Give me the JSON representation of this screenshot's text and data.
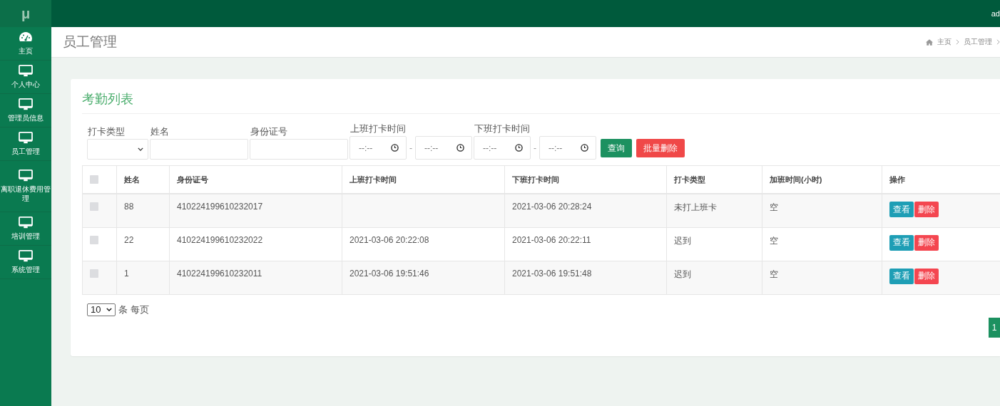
{
  "logo": "μ",
  "top_bar": {
    "user": "ad"
  },
  "sidebar": {
    "items": [
      {
        "label": "主页",
        "kind": "dashboard",
        "selected": false
      },
      {
        "label": "个人中心",
        "kind": "monitor",
        "selected": false
      },
      {
        "label": "管理员信息",
        "kind": "monitor",
        "selected": false
      },
      {
        "label": "员工管理",
        "kind": "monitor",
        "selected": false
      },
      {
        "label": "离职退休费用管理",
        "kind": "monitor",
        "selected": false
      },
      {
        "label": "培训管理",
        "kind": "monitor",
        "selected": false
      },
      {
        "label": "系统管理",
        "kind": "monitor",
        "selected": false
      }
    ]
  },
  "header": {
    "title": "员工管理",
    "breadcrumb": [
      "主页",
      "员工管理"
    ]
  },
  "card": {
    "title": "考勤列表",
    "filters": {
      "type_label": "打卡类型",
      "name_label": "姓名",
      "id_label": "身份证号",
      "start_label": "上班打卡时间",
      "start_from": "--:--",
      "start_to": "--:--",
      "range_sep_1": "-",
      "end_label": "下班打卡时间",
      "end_from": "--:--",
      "end_to": "--:--",
      "range_sep_2": "-",
      "search_button": "查询",
      "batch_delete_button": "批量删除"
    },
    "table": {
      "all_checked": false,
      "columns": [
        "姓名",
        "身份证号",
        "上班打卡时间",
        "下班打卡时间",
        "打卡类型",
        "加班时间(小时)",
        "操作"
      ],
      "rows": [
        {
          "checked": false,
          "cells": [
            "88",
            "410224199610232017",
            "",
            "2021-03-06 20:28:24",
            "未打上班卡",
            "空"
          ],
          "view": "查看",
          "delete": "删除"
        },
        {
          "checked": false,
          "cells": [
            "22",
            "410224199610232022",
            "2021-03-06 20:22:08",
            "2021-03-06 20:22:11",
            "迟到",
            "空"
          ],
          "view": "查看",
          "delete": "删除"
        },
        {
          "checked": false,
          "cells": [
            "1",
            "410224199610232011",
            "2021-03-06 19:51:46",
            "2021-03-06 19:51:48",
            "迟到",
            "空"
          ],
          "view": "查看",
          "delete": "删除"
        }
      ]
    },
    "page_size": "10",
    "page_size_label": "条 每页",
    "pages": [
      {
        "label": "1",
        "selected": true
      }
    ]
  }
}
